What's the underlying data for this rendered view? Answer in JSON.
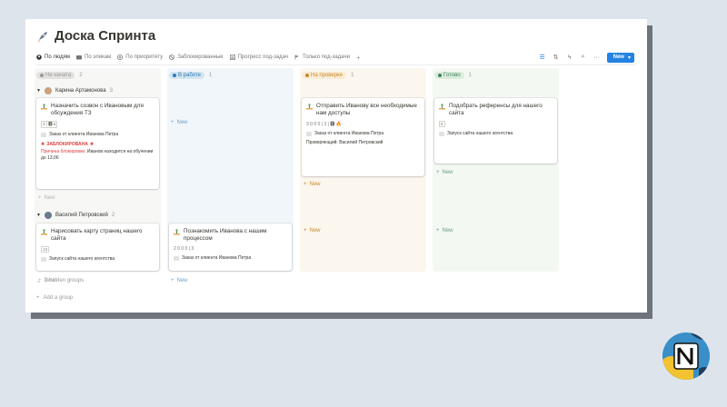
{
  "page": {
    "title": "Доска Спринта"
  },
  "views": [
    {
      "label": "По людям",
      "icon": "person-icon",
      "active": true
    },
    {
      "label": "По эпикам",
      "icon": "folder-icon",
      "active": false
    },
    {
      "label": "По приоритету",
      "icon": "priority-icon",
      "active": false
    },
    {
      "label": "Заблокированные",
      "icon": "blocked-icon",
      "active": false
    },
    {
      "label": "Прогресс под-задач",
      "icon": "checklist-icon",
      "active": false
    },
    {
      "label": "Только под-задачи",
      "icon": "flag-icon",
      "active": false
    }
  ],
  "toolbar": {
    "new_label": "New",
    "add_view": "+"
  },
  "columns": [
    {
      "label": "Не начата",
      "count": "2",
      "color": "#9b9a97",
      "pill_bg": "#e3e2e0",
      "bg": "#f7f7f5"
    },
    {
      "label": "В работе",
      "count": "1",
      "color": "#2e7bb8",
      "pill_bg": "#d3e5ef",
      "bg": "#f1f6fa"
    },
    {
      "label": "На проверке",
      "count": "1",
      "color": "#c78a2a",
      "pill_bg": "#fbecd6",
      "bg": "#fbf6ee"
    },
    {
      "label": "Готово",
      "count": "1",
      "color": "#448361",
      "pill_bg": "#dbeddb",
      "bg": "#f4f8f3"
    }
  ],
  "groups": [
    {
      "name": "Карина Артамонова",
      "count": "3"
    },
    {
      "name": "Василий Петровский",
      "count": "2"
    }
  ],
  "cards": {
    "c1": {
      "title": "Назначить созвон с Ивановым для обсуждения ТЗ",
      "meta": "3 | 🅸 6",
      "relation": "Заказ от клиента Иванова Петра",
      "blocked": "ЗАБЛОКИРОВАНА",
      "reason_label": "Причина блокировки:",
      "reason_text": "Иванов находится на обучении до 13.06"
    },
    "c2": {
      "title": "Отправить Иванову все необходимые нам доступы",
      "meta": "3 0 0 0 | 3 | 🅸 🔥",
      "relation": "Заказ от клиента Иванова Петра",
      "checked": "Проверяющий: Василий Петровский"
    },
    "c3": {
      "title": "Подобрать референсы для нашего сайта",
      "meta": "5",
      "relation": "Запуск сайта нашего агентства"
    },
    "c4": {
      "title": "Нарисовать карту страниц нашего сайта",
      "meta": "13",
      "relation": "Запуск сайта нашего агентства"
    },
    "c5": {
      "title": "Познакомить Иванова с нашим процессом",
      "meta": "2 0 0 0 | 3",
      "relation": "Заказ от клиента Иванова Петра"
    }
  },
  "labels": {
    "new": "New",
    "hidden_groups": "3 hidden groups",
    "add_group": "Add a group"
  }
}
